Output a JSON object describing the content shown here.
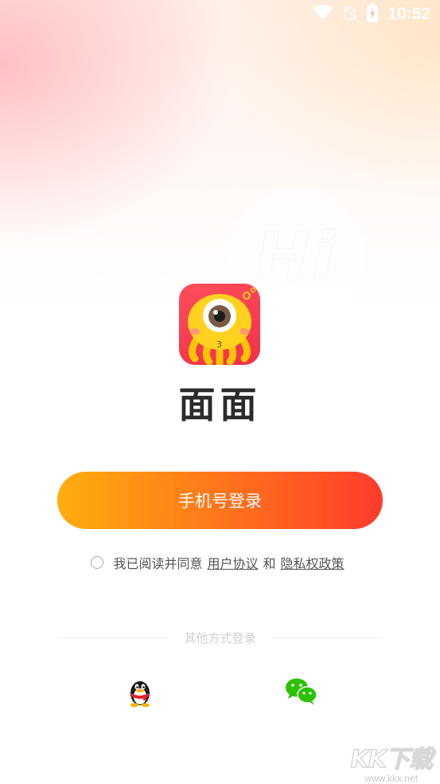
{
  "status_bar": {
    "time": "10:52",
    "icons": [
      "wifi-icon",
      "no-sim-icon",
      "battery-charging-icon"
    ]
  },
  "background": {
    "bubble_text": "Hi"
  },
  "app": {
    "name": "面面",
    "logo_icon": "one-eyed-monster-icon"
  },
  "login": {
    "phone_button_label": "手机号登录"
  },
  "agreement": {
    "prefix": "我已阅读并同意",
    "user_agreement": "用户协议",
    "and": "和",
    "privacy_policy": "隐私权政策",
    "checked": false
  },
  "other_login": {
    "label": "其他方式登录",
    "options": [
      "qq-icon",
      "wechat-icon"
    ]
  },
  "watermark": {
    "main": "KK下载",
    "sub": "www.kkx.net"
  },
  "colors": {
    "button_gradient_start": "#ffad0e",
    "button_gradient_end": "#ff3b2b",
    "logo_bg": "#f0304c",
    "wechat_green": "#2dc100"
  }
}
